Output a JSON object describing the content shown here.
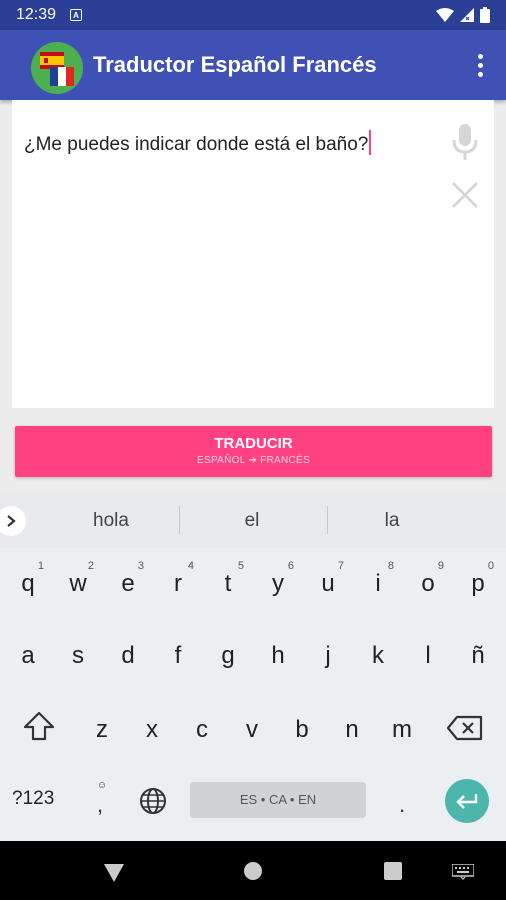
{
  "status_bar": {
    "time": "12:39",
    "notification_letter": "A"
  },
  "app_bar": {
    "title": "Traductor Español Francés",
    "logo_icons": [
      "spain-flag-icon",
      "france-flag-icon"
    ],
    "colors": {
      "app_bar": "#3f51b5",
      "status_bar": "#2b3f96",
      "logo_bg": "#4caf50"
    }
  },
  "input": {
    "text": "¿Me puedes indicar donde está el baño?",
    "mic_icon": "microphone-icon",
    "clear_icon": "close-icon"
  },
  "translate_button": {
    "label": "TRADUCIR",
    "direction": "ESPAÑOL ➔ FRANCÉS",
    "color": "#ff4081"
  },
  "keyboard": {
    "suggestions": [
      "hola",
      "el",
      "la"
    ],
    "row1": [
      {
        "ch": "q",
        "hint": "1"
      },
      {
        "ch": "w",
        "hint": "2"
      },
      {
        "ch": "e",
        "hint": "3"
      },
      {
        "ch": "r",
        "hint": "4"
      },
      {
        "ch": "t",
        "hint": "5"
      },
      {
        "ch": "y",
        "hint": "6"
      },
      {
        "ch": "u",
        "hint": "7"
      },
      {
        "ch": "i",
        "hint": "8"
      },
      {
        "ch": "o",
        "hint": "9"
      },
      {
        "ch": "p",
        "hint": "0"
      }
    ],
    "row2": [
      "a",
      "s",
      "d",
      "f",
      "g",
      "h",
      "j",
      "k",
      "l",
      "ñ"
    ],
    "row3": [
      "z",
      "x",
      "c",
      "v",
      "b",
      "n",
      "m"
    ],
    "symbols_label": "?123",
    "emoji_hint": "☺",
    "comma": ",",
    "space_label": "ES • CA • EN",
    "period": ".",
    "enter_color": "#4db6ac"
  }
}
